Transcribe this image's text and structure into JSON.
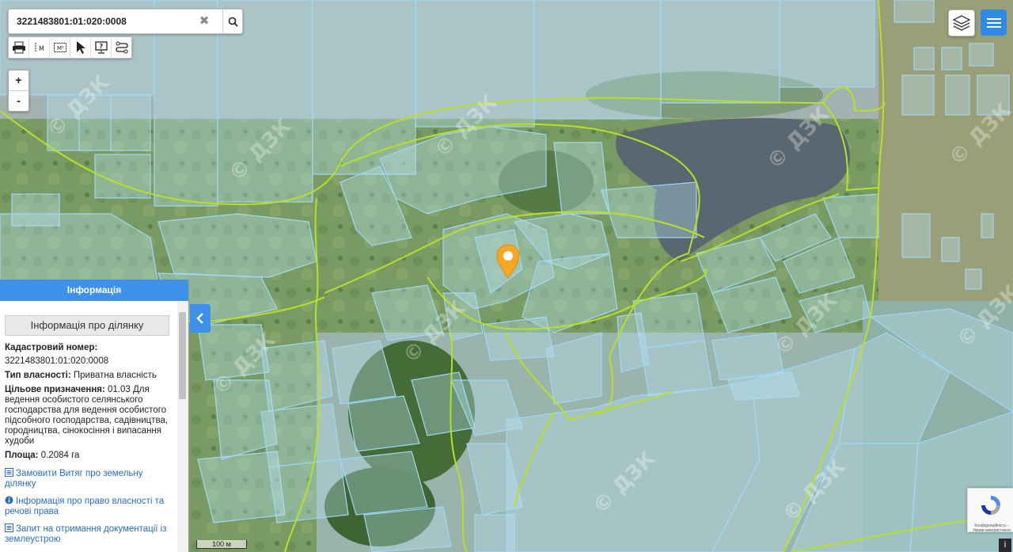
{
  "search": {
    "value": "3221483801:01:020:0008",
    "clear_glyph": "✖"
  },
  "toolbar": {
    "tools": [
      {
        "name": "print-icon"
      },
      {
        "name": "measure-distance-icon",
        "text": "M"
      },
      {
        "name": "measure-area-icon",
        "text": "M²"
      },
      {
        "name": "select-pointer-icon"
      },
      {
        "name": "identify-icon"
      },
      {
        "name": "route-icon"
      }
    ]
  },
  "zoom": {
    "in": "+",
    "out": "-"
  },
  "panel": {
    "header": "Інформація",
    "subheader": "Інформація про ділянку",
    "cadastral_label": "Кадастровий номер:",
    "cadastral_value": "3221483801:01:020:0008",
    "ownership_label": "Тип власності:",
    "ownership_value": "Приватна власність",
    "purpose_label": "Цільове призначення:",
    "purpose_value": "01.03 Для ведення особистого селянського господарства для ведення особистого підсобного господарства, садівництва, городництва, сінокосіння і випасання худоби",
    "area_label": "Площа:",
    "area_value": "0.2084 га",
    "links": [
      "Замовити Витяг про земельну ділянку",
      "Інформація про право власності та речові права",
      "Запит на отримання документації із землеустрою"
    ]
  },
  "scalebar": {
    "label": "100 м"
  },
  "watermark": "© ДЗК",
  "recaptcha": {
    "text": "Конфіденційність - Умови використання"
  },
  "info_button": "i",
  "colors": {
    "accent": "#3d91e8",
    "parcel_stroke": "#9fd8f5",
    "boundary_stroke": "#b8e02a",
    "marker": "#f5a623"
  }
}
